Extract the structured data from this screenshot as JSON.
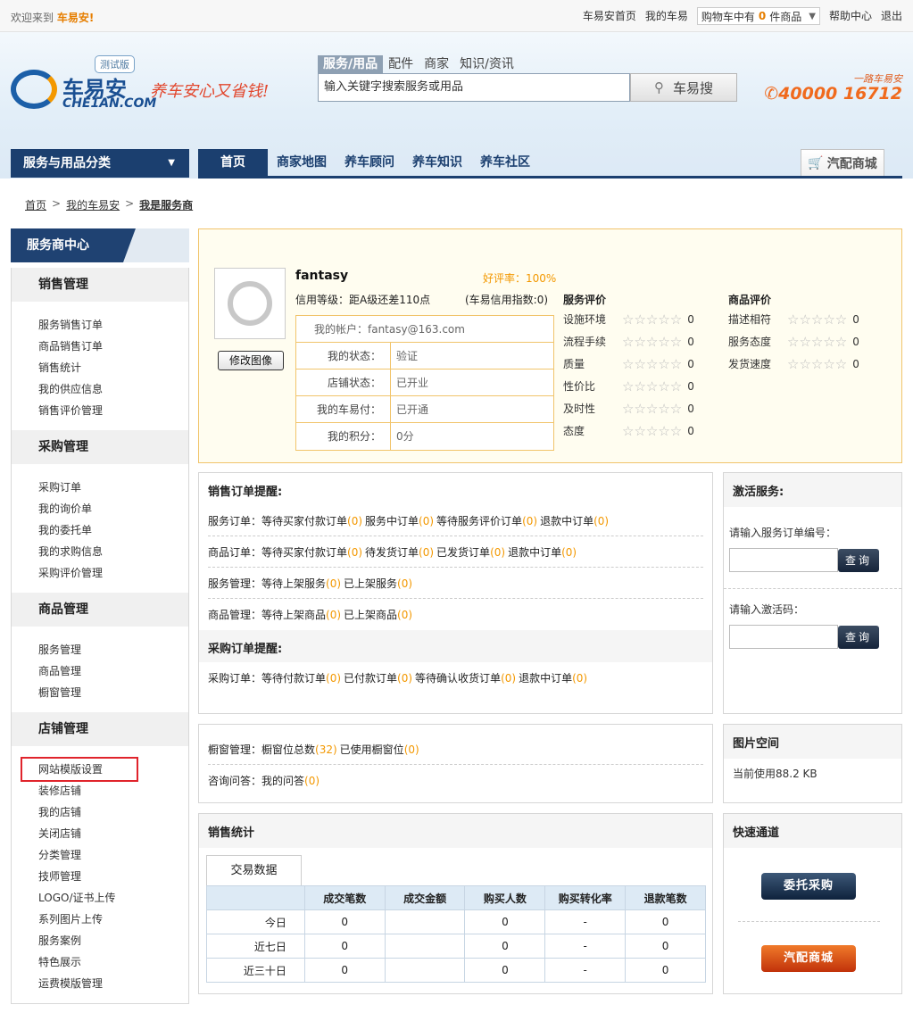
{
  "topbar": {
    "welcome": "欢迎来到",
    "brand": "车易安!",
    "links": [
      "车易安首页",
      "我的车易"
    ],
    "cart_prefix": "购物车中有",
    "cart_count": "0",
    "cart_suffix": "件商品",
    "help": "帮助中心",
    "logout": "退出"
  },
  "header": {
    "logo_text": "车易安",
    "logo_en": "CHE1AN.COM",
    "beta": "测试版",
    "slogan": "养车安心又省钱!",
    "search_tabs": [
      "服务/用品",
      "配件",
      "商家",
      "知识/资讯"
    ],
    "search_value": "输入关键字搜索服务或用品",
    "search_button": "车易搜",
    "hotline_tag": "一路车易安",
    "hotline": "40000 16712"
  },
  "nav": {
    "category": "服务与用品分类",
    "items": [
      "首页",
      "商家地图",
      "养车顾问",
      "养车知识",
      "养车社区"
    ],
    "parts_mall": "汽配商城"
  },
  "breadcrumb": [
    "首页",
    "我的车易安",
    "我是服务商"
  ],
  "sidebar": {
    "title": "服务商中心",
    "sections": [
      {
        "title": "销售管理",
        "items": [
          "服务销售订单",
          "商品销售订单",
          "销售统计",
          "我的供应信息",
          "销售评价管理"
        ]
      },
      {
        "title": "采购管理",
        "items": [
          "采购订单",
          "我的询价单",
          "我的委托单",
          "我的求购信息",
          "采购评价管理"
        ]
      },
      {
        "title": "商品管理",
        "items": [
          "服务管理",
          "商品管理",
          "橱窗管理"
        ]
      },
      {
        "title": "店铺管理",
        "items": [
          "网站模版设置",
          "装修店铺",
          "我的店铺",
          "关闭店铺",
          "分类管理",
          "技师管理",
          "LOGO/证书上传",
          "系列图片上传",
          "服务案例",
          "特色展示",
          "运费模版管理"
        ]
      }
    ]
  },
  "profile": {
    "name": "fantasy",
    "rate": "好评率：100%",
    "level": "信用等级：距A级还差110点",
    "index": "(车易信用指数:0)",
    "avatar_button": "修改图像",
    "account": "我的帐户：fantasy@163.com",
    "rows": [
      {
        "k": "我的状态：",
        "v": "验证"
      },
      {
        "k": "店铺状态：",
        "v": "已开业"
      },
      {
        "k": "我的车易付：",
        "v": "已开通"
      },
      {
        "k": "我的积分：",
        "v": "0分"
      }
    ],
    "service_title": "服务评价",
    "service": [
      {
        "label": "设施环境",
        "stars": 0,
        "value": "0"
      },
      {
        "label": "流程手续",
        "stars": 0,
        "value": "0"
      },
      {
        "label": "质量",
        "stars": 0,
        "value": "0"
      },
      {
        "label": "性价比",
        "stars": 0,
        "value": "0"
      },
      {
        "label": "及时性",
        "stars": 0,
        "value": "0"
      },
      {
        "label": "态度",
        "stars": 0,
        "value": "0"
      }
    ],
    "goods_title": "商品评价",
    "goods": [
      {
        "label": "描述相符",
        "stars": 0,
        "value": "0"
      },
      {
        "label": "服务态度",
        "stars": 0,
        "value": "0"
      },
      {
        "label": "发货速度",
        "stars": 0,
        "value": "0"
      }
    ]
  },
  "orders": {
    "sales_title": "销售订单提醒:",
    "purchase_title": "采购订单提醒:",
    "sales_rows": [
      {
        "label": "服务订单：",
        "items": [
          {
            "t": "等待买家付款订单",
            "c": "(0)"
          },
          {
            "t": "服务中订单",
            "c": "(0)"
          },
          {
            "t": "等待服务评价订单",
            "c": "(0)"
          },
          {
            "t": "退款中订单",
            "c": "(0)"
          }
        ]
      },
      {
        "label": "商品订单：",
        "items": [
          {
            "t": "等待买家付款订单",
            "c": "(0)"
          },
          {
            "t": "待发货订单",
            "c": "(0)"
          },
          {
            "t": "已发货订单",
            "c": "(0)"
          },
          {
            "t": "退款中订单",
            "c": "(0)"
          }
        ]
      },
      {
        "label": "服务管理：",
        "items": [
          {
            "t": "等待上架服务",
            "c": "(0)"
          },
          {
            "t": "已上架服务",
            "c": "(0)"
          }
        ]
      },
      {
        "label": "商品管理：",
        "items": [
          {
            "t": "等待上架商品",
            "c": "(0)"
          },
          {
            "t": "已上架商品",
            "c": "(0)"
          }
        ]
      }
    ],
    "purchase_rows": [
      {
        "label": "采购订单：",
        "items": [
          {
            "t": "等待付款订单",
            "c": "(0)"
          },
          {
            "t": "已付款订单",
            "c": "(0)"
          },
          {
            "t": "等待确认收货订单",
            "c": "(0)"
          },
          {
            "t": "退款中订单",
            "c": "(0)"
          }
        ]
      }
    ]
  },
  "activate": {
    "title": "激活服务:",
    "label1": "请输入服务订单编号：",
    "label2": "请输入激活码：",
    "button": "查询"
  },
  "showcase": {
    "rows": [
      {
        "label": "橱窗管理：",
        "items": [
          {
            "t": "橱窗位总数",
            "c": "(32)"
          },
          {
            "t": "已使用橱窗位",
            "c": "(0)"
          }
        ]
      },
      {
        "label": "咨询问答：",
        "items": [
          {
            "t": "我的问答",
            "c": "(0)"
          }
        ]
      }
    ]
  },
  "images": {
    "title": "图片空间",
    "usage": "当前使用88.2 KB"
  },
  "stats": {
    "title": "销售统计",
    "tab": "交易数据",
    "headers": [
      "",
      "成交笔数",
      "成交金额",
      "购买人数",
      "购买转化率",
      "退款笔数"
    ],
    "rows": [
      [
        "今日",
        "0",
        "",
        "0",
        "-",
        "0"
      ],
      [
        "近七日",
        "0",
        "",
        "0",
        "-",
        "0"
      ],
      [
        "近三十日",
        "0",
        "",
        "0",
        "-",
        "0"
      ]
    ]
  },
  "quick": {
    "title": "快速通道",
    "btn1": "委托采购",
    "btn2": "汽配商城"
  }
}
